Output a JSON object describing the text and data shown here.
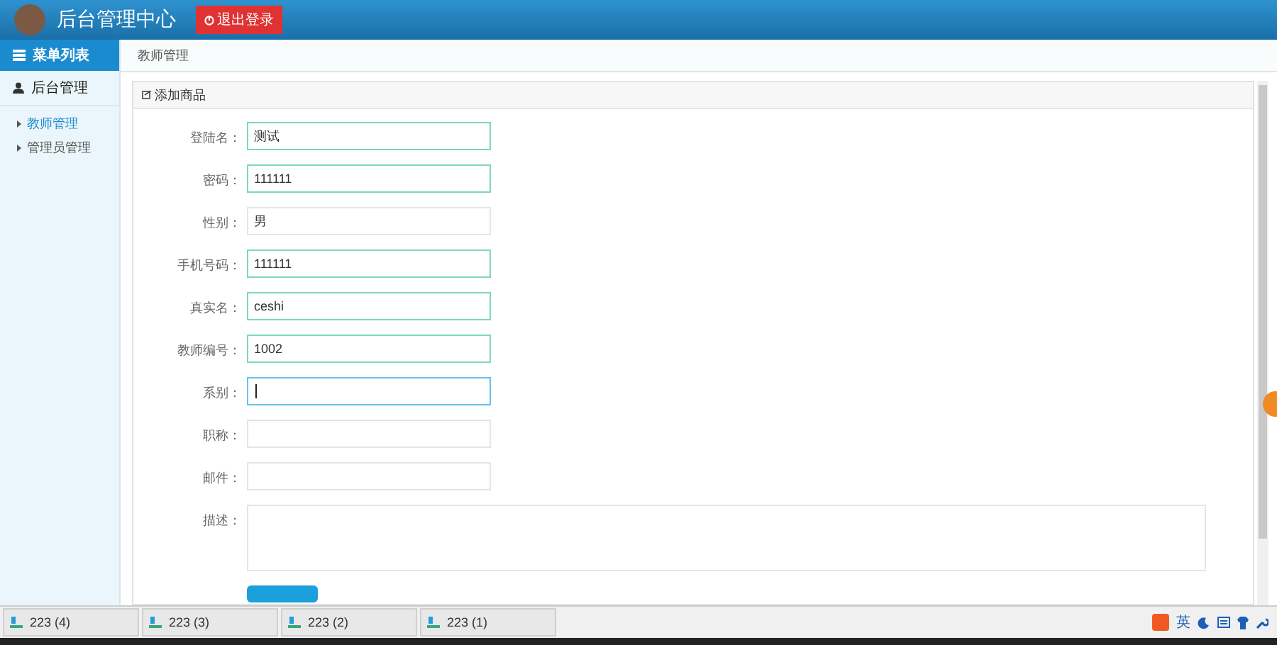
{
  "header": {
    "title": "后台管理中心",
    "logout_button": "退出登录"
  },
  "sidebar": {
    "heading": "菜单列表",
    "group": {
      "label": "后台管理",
      "items": [
        {
          "label": "教师管理",
          "selected": true
        },
        {
          "label": "管理员管理",
          "selected": false
        }
      ]
    }
  },
  "breadcrumb": "教师管理",
  "panel": {
    "title": "添加商品",
    "fields": [
      {
        "kind": "input",
        "label": "登陆名：",
        "value": "测试",
        "highlighted": true,
        "focused": false
      },
      {
        "kind": "input",
        "label": "密码：",
        "value": "111111",
        "highlighted": true,
        "focused": false
      },
      {
        "kind": "input",
        "label": "性别：",
        "value": "男",
        "highlighted": false,
        "focused": false
      },
      {
        "kind": "input",
        "label": "手机号码：",
        "value": "111111",
        "highlighted": true,
        "focused": false
      },
      {
        "kind": "input",
        "label": "真实名：",
        "value": "ceshi",
        "highlighted": true,
        "focused": false
      },
      {
        "kind": "input",
        "label": "教师编号：",
        "value": "1002",
        "highlighted": true,
        "focused": false
      },
      {
        "kind": "input",
        "label": "系别：",
        "highlighted": true,
        "focused": true
      },
      {
        "kind": "input",
        "label": "职称：",
        "highlighted": false,
        "focused": false
      },
      {
        "kind": "input",
        "label": "邮件：",
        "highlighted": false,
        "focused": false
      },
      {
        "kind": "textarea",
        "label": "描述：",
        "highlighted": false,
        "focused": false
      }
    ]
  },
  "taskbar": {
    "windows": [
      {
        "label": "223 (4)"
      },
      {
        "label": "223 (3)"
      },
      {
        "label": "223 (2)"
      },
      {
        "label": "223 (1)"
      }
    ],
    "ime": {
      "language": "英"
    }
  }
}
